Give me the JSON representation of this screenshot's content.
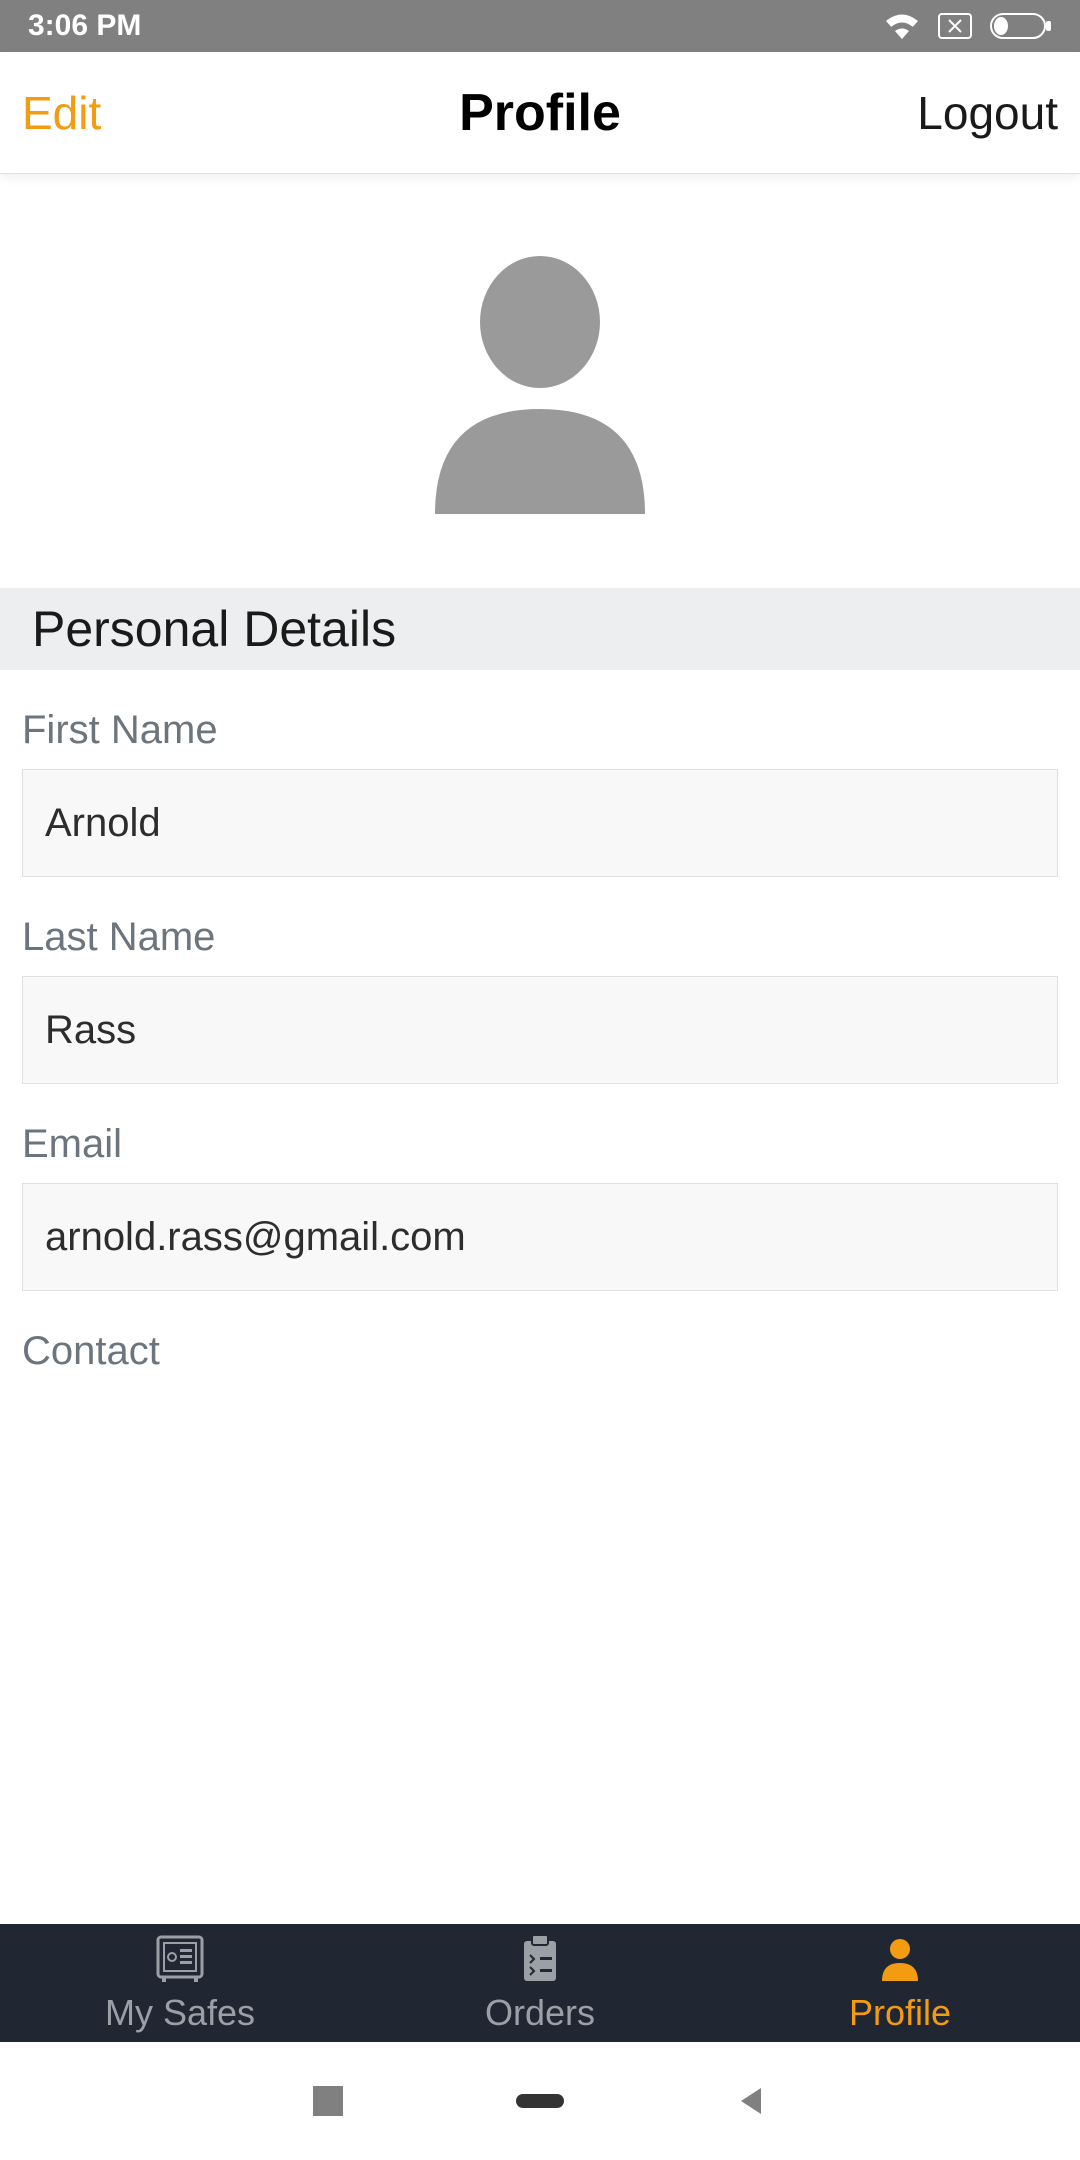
{
  "status": {
    "time": "3:06 PM"
  },
  "header": {
    "edit": "Edit",
    "title": "Profile",
    "logout": "Logout"
  },
  "section": {
    "personal_details": "Personal Details"
  },
  "fields": {
    "first_name": {
      "label": "First Name",
      "value": "Arnold"
    },
    "last_name": {
      "label": "Last Name",
      "value": "Rass"
    },
    "email": {
      "label": "Email",
      "value": "arnold.rass@gmail.com"
    },
    "contact": {
      "label": "Contact"
    }
  },
  "nav": {
    "my_safes": "My Safes",
    "orders": "Orders",
    "profile": "Profile",
    "active": "profile"
  },
  "colors": {
    "accent": "#F39C12"
  }
}
